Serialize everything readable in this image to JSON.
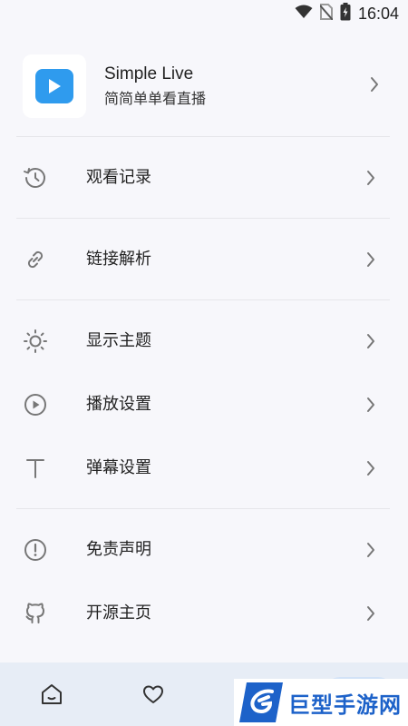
{
  "status_bar": {
    "time": "16:04",
    "icons": [
      "wifi-icon",
      "no-sim-icon",
      "battery-icon"
    ]
  },
  "app": {
    "name": "Simple Live",
    "slogan": "简简单单看直播",
    "logo_icon": "play-icon",
    "accent_color": "#2f9bee"
  },
  "menu": {
    "history": {
      "label": "观看记录",
      "icon": "history-icon"
    },
    "link_parse": {
      "label": "链接解析",
      "icon": "link-icon"
    },
    "theme": {
      "label": "显示主题",
      "icon": "sun-icon"
    },
    "playback": {
      "label": "播放设置",
      "icon": "play-circle-icon"
    },
    "danmaku": {
      "label": "弹幕设置",
      "icon": "text-icon"
    },
    "disclaimer": {
      "label": "免责声明",
      "icon": "alert-circle-icon"
    },
    "open_source": {
      "label": "开源主页",
      "icon": "github-icon"
    }
  },
  "bottom_nav": {
    "items": [
      "home-icon",
      "heart-icon"
    ]
  },
  "watermark": {
    "text": "巨型手游网",
    "color": "#1d62c9"
  }
}
